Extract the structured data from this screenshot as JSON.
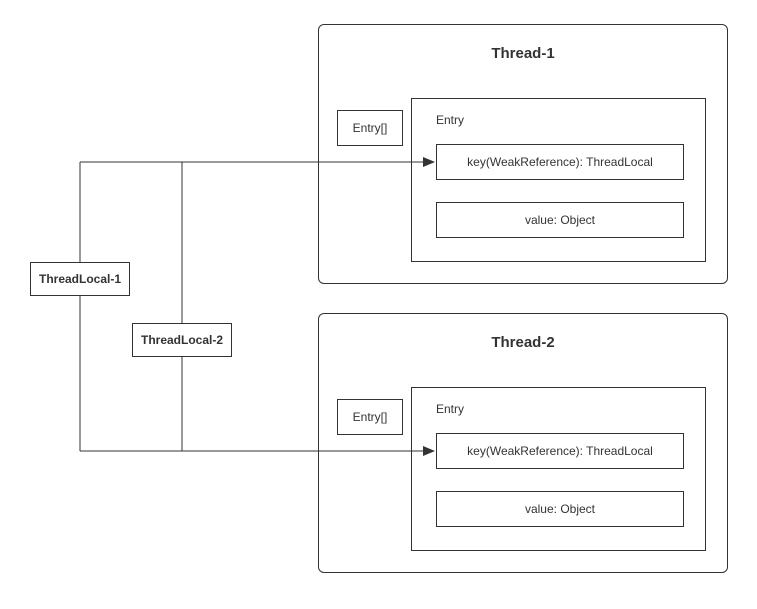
{
  "threadlocals": [
    {
      "label": "ThreadLocal-1"
    },
    {
      "label": "ThreadLocal-2"
    }
  ],
  "threads": [
    {
      "title": "Thread-1",
      "entry_arr_label": "Entry[]",
      "entry_label": "Entry",
      "key_label": "key(WeakReference): ThreadLocal",
      "value_label": "value: Object"
    },
    {
      "title": "Thread-2",
      "entry_arr_label": "Entry[]",
      "entry_label": "Entry",
      "key_label": "key(WeakReference): ThreadLocal",
      "value_label": "value: Object"
    }
  ]
}
